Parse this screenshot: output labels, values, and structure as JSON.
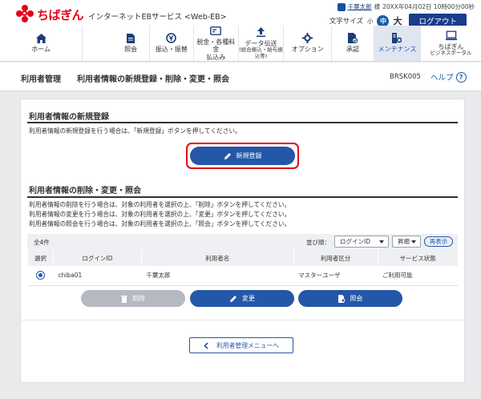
{
  "header": {
    "bank_name": "ちばぎん",
    "service_name": "インターネットEBサービス <Web-EB>",
    "user_name": "千葉太郎",
    "user_suffix": "様",
    "login_time": "20XX年04月02日 10時00分00秒",
    "font_size_label": "文字サイズ",
    "font_small": "小",
    "font_medium": "中",
    "font_large": "大",
    "logout": "ログアウト"
  },
  "nav": {
    "items": [
      {
        "label": "ホーム",
        "icon": "home-icon"
      },
      {
        "label": "照会",
        "icon": "document-icon"
      },
      {
        "label": "振込・振替",
        "icon": "yen-icon"
      },
      {
        "label": "税金・各種料金",
        "label2": "払込み",
        "icon": "tax-icon"
      },
      {
        "label": "データ伝送",
        "label2": "(総合振込・給与振込等)",
        "icon": "upload-icon"
      },
      {
        "label": "オプション",
        "icon": "gear-icon"
      },
      {
        "label": "承認",
        "icon": "approval-icon"
      },
      {
        "label": "メンテナンス",
        "icon": "maintenance-icon",
        "active": true
      },
      {
        "label": "ちばぎん",
        "label2": "ビジネスポータル",
        "icon": "portal-icon"
      }
    ]
  },
  "page": {
    "parent": "利用者管理",
    "title": "利用者情報の新規登録・削除・変更・照会",
    "code": "BRSK005",
    "help": "ヘルプ"
  },
  "section_register": {
    "title": "利用者情報の新規登録",
    "text": "利用者情報の新規登録を行う場合は、「新規登録」ボタンを押してください。",
    "button": "新規登録"
  },
  "section_manage": {
    "title": "利用者情報の削除・変更・照会",
    "lines": [
      "利用者情報の削除を行う場合は、対象の利用者を選択の上、「削除」ボタンを押してください。",
      "利用者情報の変更を行う場合は、対象の利用者を選択の上、「変更」ボタンを押してください。",
      "利用者情報の照会を行う場合は、対象の利用者を選択の上、「照会」ボタンを押してください。"
    ]
  },
  "list": {
    "count": "全4件",
    "sort_label": "並び順：",
    "sort_key": "ログインID",
    "sort_order": "昇順",
    "redisplay": "再表示",
    "columns": [
      "選択",
      "ログインID",
      "利用者名",
      "利用者区分",
      "サービス状態"
    ],
    "rows": [
      {
        "login_id": "chiba01",
        "user_name": "千葉太郎",
        "user_type": "マスターユーザ",
        "status": "ご利用可能"
      }
    ]
  },
  "actions": {
    "delete": "削除",
    "change": "変更",
    "inquiry": "照会"
  },
  "back": "利用者管理メニューへ",
  "colors": {
    "brand_red": "#e60012",
    "primary_blue": "#2457a8",
    "navy": "#1a3c8c",
    "disabled_gray": "#b4b9c2"
  }
}
